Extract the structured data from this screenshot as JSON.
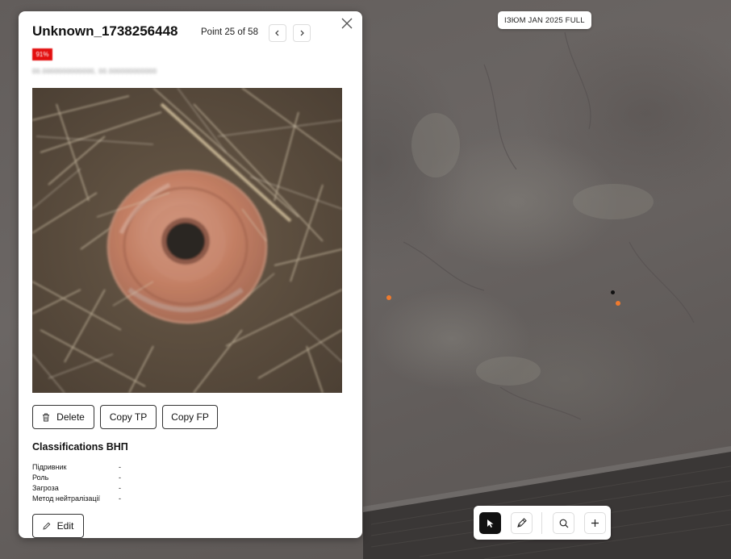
{
  "map": {
    "dataset_label": "ІЗЮМ JAN 2025 FULL",
    "markers": [
      {
        "color": "#ef7a2e"
      },
      {
        "color": "#ef7a2e"
      },
      {
        "color": "#111111"
      }
    ]
  },
  "panel": {
    "title": "Unknown_1738256448",
    "point_counter": "Point 25 of 58",
    "confidence": "91%",
    "confidence_color": "#e30f0f",
    "coords": "00.0000000000000, 00.000000000000",
    "actions": {
      "delete": "Delete",
      "copy_tp": "Copy TP",
      "copy_fp": "Copy FP"
    },
    "classifications": {
      "title": "Classifications ВНП",
      "fields": [
        {
          "label": "Підривник",
          "value": "-"
        },
        {
          "label": "Роль",
          "value": "-"
        },
        {
          "label": "Загроза",
          "value": "-"
        },
        {
          "label": "Метод нейтралізації",
          "value": "-"
        }
      ]
    },
    "edit_label": "Edit",
    "icons": {
      "close": "close-icon",
      "prev": "chevron-left-icon",
      "next": "chevron-right-icon",
      "trash": "trash-icon",
      "pencil": "pencil-icon"
    }
  },
  "toolbar": {
    "tools": [
      {
        "name": "select-tool",
        "icon": "cursor-icon",
        "active": true
      },
      {
        "name": "draw-tool",
        "icon": "pen-icon",
        "active": false
      },
      {
        "name": "search-tool",
        "icon": "search-icon",
        "active": false
      },
      {
        "name": "add-tool",
        "icon": "plus-icon",
        "active": false
      }
    ]
  }
}
